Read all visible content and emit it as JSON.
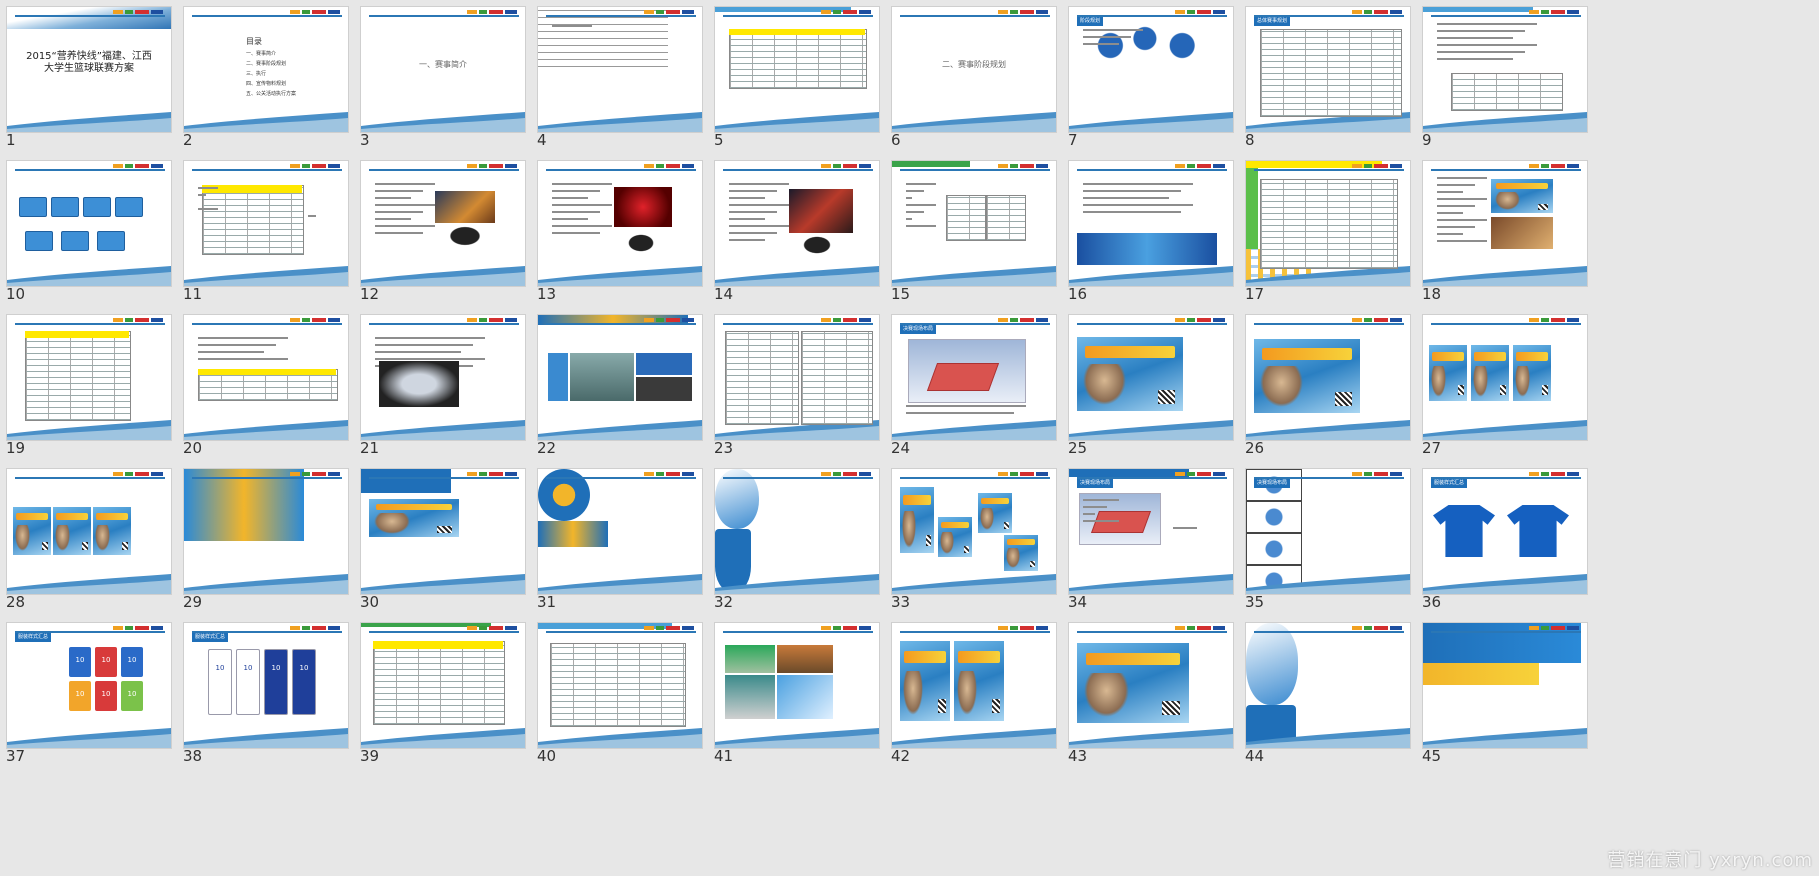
{
  "grid": {
    "slide_numbers": [
      "1",
      "2",
      "3",
      "4",
      "5",
      "6",
      "7",
      "8",
      "9",
      "10",
      "11",
      "12",
      "13",
      "14",
      "15",
      "16",
      "17",
      "18",
      "19",
      "20",
      "21",
      "22",
      "23",
      "24",
      "25",
      "26",
      "27",
      "28",
      "29",
      "30",
      "31",
      "32",
      "33",
      "34",
      "35",
      "36",
      "37",
      "38",
      "39",
      "40",
      "41",
      "42",
      "43",
      "44",
      "45"
    ]
  },
  "slides": {
    "s1": {
      "title": "2015“营养快线”福建、江西\n大学生篮球联赛方案"
    },
    "s2": {
      "toc_heading": "目录",
      "toc_items": [
        "一、赛事简介",
        "二、赛事阶段规划",
        "三、执行",
        "四、宣传物料规划",
        "五、公关活动执行方案"
      ]
    },
    "s3": {
      "section": "一、赛事简介"
    },
    "s6": {
      "section": "二、赛事阶段规划"
    },
    "s7": {
      "header": "阶段规划"
    },
    "s8": {
      "header": "总体赛事规划"
    },
    "s24": {
      "header": "决赛现场布局"
    },
    "s34": {
      "header": "决赛现场布局"
    },
    "s35": {
      "header": "决赛现场布局"
    },
    "s36": {
      "header": "服装样式汇总"
    },
    "s37": {
      "header": "服装样式汇总"
    },
    "s38": {
      "header": "服装样式汇总"
    },
    "jersey_number": "10"
  },
  "watermark": "营销在意门 yxryn.com",
  "colors": {
    "background": "#e7e7e7",
    "slide_bg": "#ffffff",
    "accent_blue": "#2b77b5",
    "header_blue": "#1f6fb8",
    "highlight_yellow": "#ffe800"
  }
}
